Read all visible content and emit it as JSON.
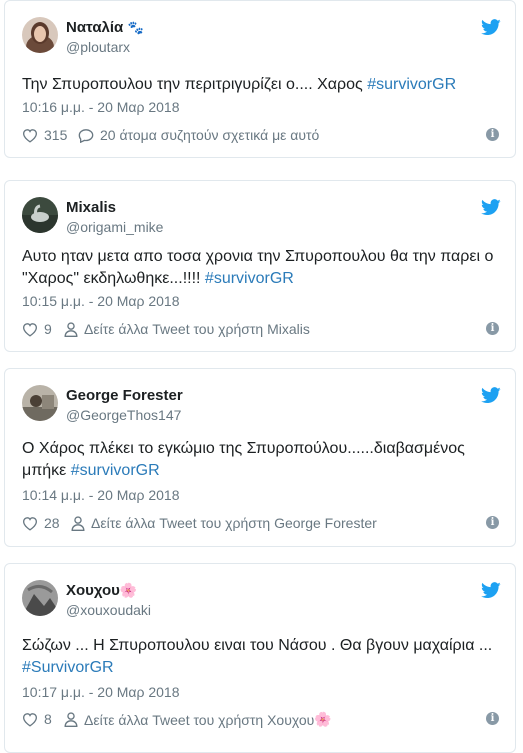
{
  "tweets": [
    {
      "name": "Ναταλία",
      "name_suffix": "🐾",
      "handle": "@ploutarx",
      "text_before": "Την Σπυροπουλου την περιτριγυρίζει ο.... Χαρος ",
      "hashtag": "#survivorGR",
      "text_after": "",
      "time": "10:16 μ.μ. - 20 Μαρ 2018",
      "likes": "315",
      "secondary": "20 άτομα συζητούν σχετικά με αυτό",
      "secondary_icon": "reply-icon"
    },
    {
      "name": "Mixalis",
      "name_suffix": "",
      "handle": "@origami_mike",
      "text_before": "Αυτο ηταν μετα απο τοσα χρονια την Σπυροπουλου θα την παρει ο \"Χαρος\" εκδηλωθηκε...!!!! ",
      "hashtag": "#survivorGR",
      "text_after": "",
      "time": "10:15 μ.μ. - 20 Μαρ 2018",
      "likes": "9",
      "secondary": "Δείτε άλλα Tweet του χρήστη Mixalis",
      "secondary_icon": "user-icon"
    },
    {
      "name": "George Forester",
      "name_suffix": "",
      "handle": "@GeorgeThos147",
      "text_before": "Ο Χάρος πλέκει το εγκώμιο της Σπυροπούλου......διαβασμένος μπήκε  ",
      "hashtag": "#survivorGR",
      "text_after": "",
      "time": "10:14 μ.μ. - 20 Μαρ 2018",
      "likes": "28",
      "secondary": "Δείτε άλλα Tweet του χρήστη George Forester",
      "secondary_icon": "user-icon"
    },
    {
      "name": "Χουχου",
      "name_suffix": "🌸",
      "handle": "@xouxoudaki",
      "text_before": "Σώζων ... Η Σπυροπουλου ειναι του Νάσου . Θα βγουν μαχαίρια ... ",
      "hashtag": "#SurvivorGR",
      "text_after": "",
      "time": "10:17 μ.μ. - 20 Μαρ 2018",
      "likes": "8",
      "secondary": "Δείτε άλλα Tweet του χρήστη Χουχου",
      "secondary_suffix": "🌸",
      "secondary_icon": "user-icon"
    }
  ],
  "colors": {
    "hashtag": "#2b7bb9",
    "twitter_blue": "#1da1f2",
    "meta_gray": "#697882",
    "border": "#e1e8ed"
  }
}
